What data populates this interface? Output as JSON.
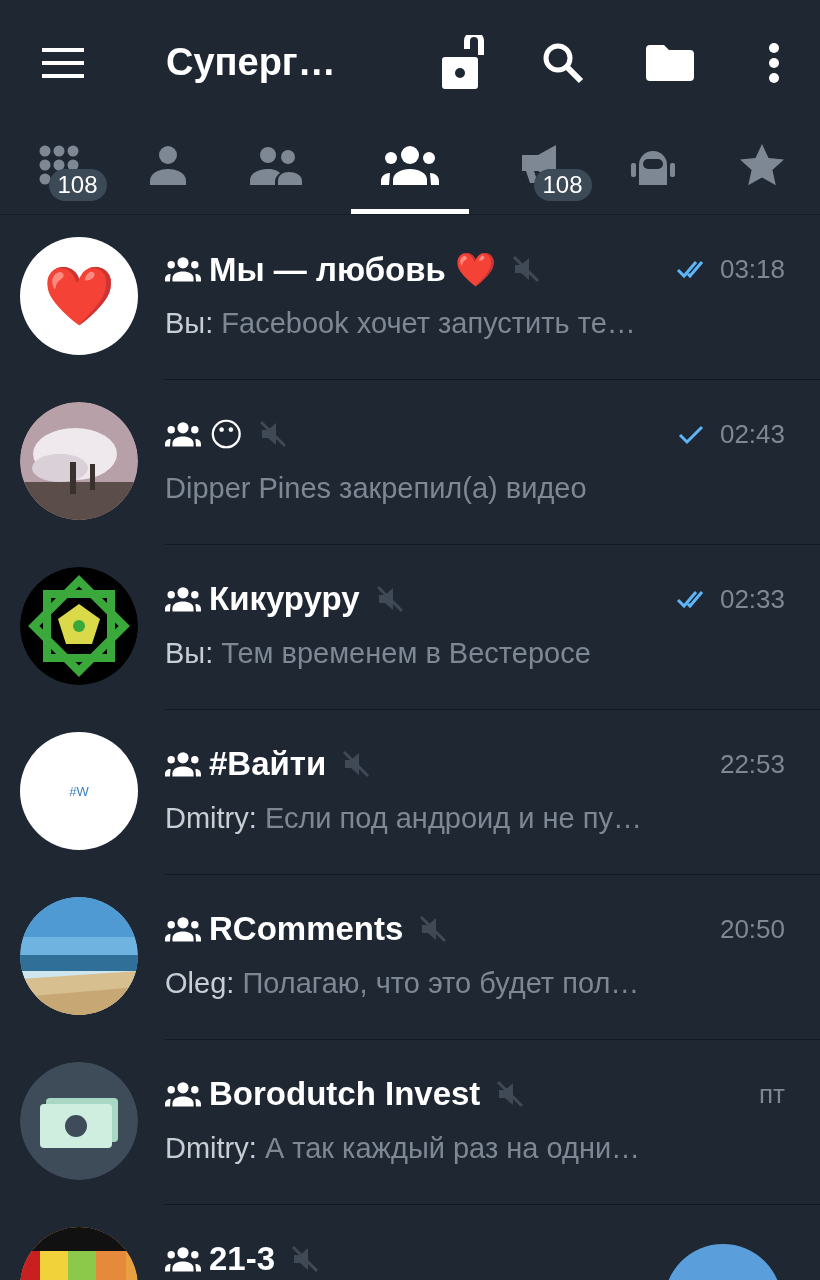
{
  "header": {
    "title": "Суперг…"
  },
  "tabs": [
    {
      "kind": "all",
      "selected": false,
      "badge": "108"
    },
    {
      "kind": "user",
      "selected": false
    },
    {
      "kind": "users",
      "selected": false
    },
    {
      "kind": "group",
      "selected": true
    },
    {
      "kind": "channel",
      "selected": false,
      "badge": "108"
    },
    {
      "kind": "bot",
      "selected": false
    },
    {
      "kind": "star",
      "selected": false
    }
  ],
  "chats": [
    {
      "avatar": {
        "kind": "emoji",
        "text": "❤️"
      },
      "name": "Мы — любовь ❤️",
      "muted": true,
      "read": true,
      "time": "03:18",
      "sender": "Вы:",
      "preview": "Facebook хочет запустить те…"
    },
    {
      "name": "😶",
      "muted": true,
      "read": false,
      "time": "02:43",
      "preview": "Dipper Pines закрепил(а) видео"
    },
    {
      "avatar": {
        "kind": "logo"
      },
      "name": "Кикуруру",
      "muted": true,
      "read": true,
      "time": "02:33",
      "sender": "Вы:",
      "preview": "Тем временем в Вестеросе"
    },
    {
      "avatar": {
        "kind": "text",
        "text": "#W"
      },
      "name": "#Вайти",
      "muted": true,
      "time": "22:53",
      "sender": "Dmitry:",
      "preview": "Если под андроид и не пу…"
    },
    {
      "name": "RComments",
      "muted": true,
      "time": "20:50",
      "sender": "Oleg:",
      "preview": "Полагаю, что это будет пол…"
    },
    {
      "avatar": {
        "kind": "money"
      },
      "name": "Borodutch Invest",
      "muted": true,
      "time": "пт",
      "sender": "Dmitry:",
      "preview": "А так каждый раз на одни…"
    },
    {
      "name": "21-3",
      "muted": true
    }
  ]
}
